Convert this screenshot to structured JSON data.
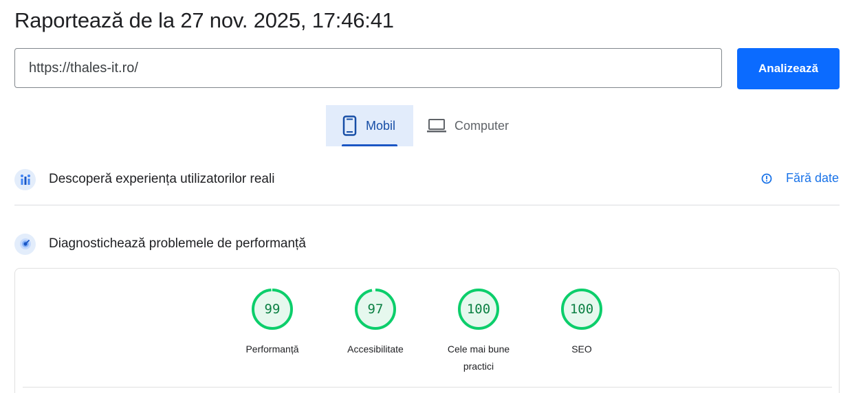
{
  "header": {
    "title": "Raportează de la 27 nov. 2025, 17:46:41"
  },
  "url_input": {
    "value": "https://thales-it.ro/"
  },
  "analyze_button": {
    "label": "Analizează"
  },
  "tabs": [
    {
      "label": "Mobil",
      "icon": "smartphone-icon",
      "selected": true
    },
    {
      "label": "Computer",
      "icon": "laptop-icon",
      "selected": false
    }
  ],
  "crux_section": {
    "title": "Descoperă experiența utilizatorilor reali",
    "status": "Fără date",
    "status_icon": "info-icon"
  },
  "diagnostics_section": {
    "title": "Diagnostichează problemele de performanță"
  },
  "scores": [
    {
      "value": 99,
      "label": "Performanță"
    },
    {
      "value": 97,
      "label": "Accesibilitate"
    },
    {
      "value": 100,
      "label": "Cele mai bune practici"
    },
    {
      "value": 100,
      "label": "SEO"
    }
  ],
  "colors": {
    "accent_blue": "#0b6bff",
    "good_green": "#0cce6b",
    "good_green_text": "#0b8043",
    "good_green_fill": "#e6f8ee",
    "tab_selected_bg": "#e2ecfb"
  }
}
